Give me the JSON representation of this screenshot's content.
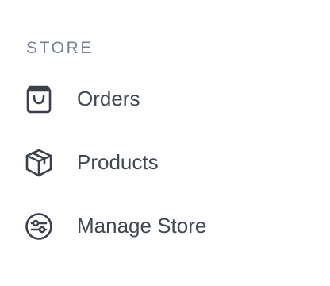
{
  "sidebar": {
    "section_title": "STORE",
    "items": [
      {
        "label": "Orders",
        "icon": "shopping-bag-icon"
      },
      {
        "label": "Products",
        "icon": "package-box-icon"
      },
      {
        "label": "Manage Store",
        "icon": "settings-sliders-icon"
      }
    ]
  },
  "colors": {
    "section_title": "#77818d",
    "item_text": "#404852",
    "icon": "#3a414a",
    "background": "#ffffff"
  }
}
